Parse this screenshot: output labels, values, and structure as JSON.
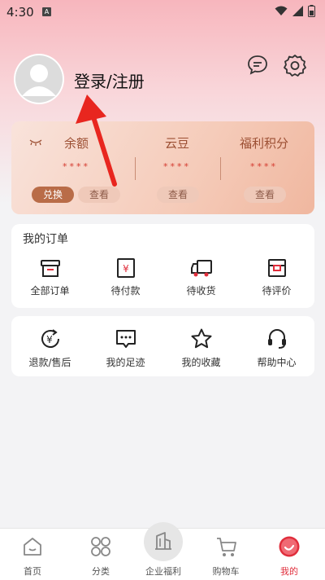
{
  "status_bar": {
    "time": "4:30",
    "notification_icon": "A"
  },
  "header": {
    "login_label": "登录/注册",
    "message_icon": "chat-bubble-icon",
    "settings_icon": "gear-icon"
  },
  "wallet": {
    "balance": {
      "title": "余额",
      "value": "****",
      "exchange_label": "兑换",
      "view_label": "查看"
    },
    "yundou": {
      "title": "云豆",
      "value": "****",
      "view_label": "查看"
    },
    "points": {
      "title": "福利积分",
      "value": "****",
      "view_label": "查看"
    }
  },
  "orders": {
    "title": "我的订单",
    "items": [
      {
        "label": "全部订单",
        "icon": "box-icon"
      },
      {
        "label": "待付款",
        "icon": "yen-wallet-icon"
      },
      {
        "label": "待收货",
        "icon": "truck-icon"
      },
      {
        "label": "待评价",
        "icon": "review-box-icon"
      }
    ]
  },
  "services": {
    "items": [
      {
        "label": "退款/售后",
        "icon": "refund-icon"
      },
      {
        "label": "我的足迹",
        "icon": "footprint-icon"
      },
      {
        "label": "我的收藏",
        "icon": "star-icon"
      },
      {
        "label": "帮助中心",
        "icon": "headset-icon"
      }
    ]
  },
  "tabbar": {
    "items": [
      {
        "label": "首页",
        "icon": "home-icon"
      },
      {
        "label": "分类",
        "icon": "category-icon"
      },
      {
        "label": "企业福利",
        "icon": "building-icon"
      },
      {
        "label": "购物车",
        "icon": "cart-icon"
      },
      {
        "label": "我的",
        "icon": "profile-icon"
      }
    ],
    "active_index": 4
  },
  "colors": {
    "accent": "#e02e3c",
    "wallet_text": "#9c4f33",
    "stars": "#d43a2f"
  }
}
